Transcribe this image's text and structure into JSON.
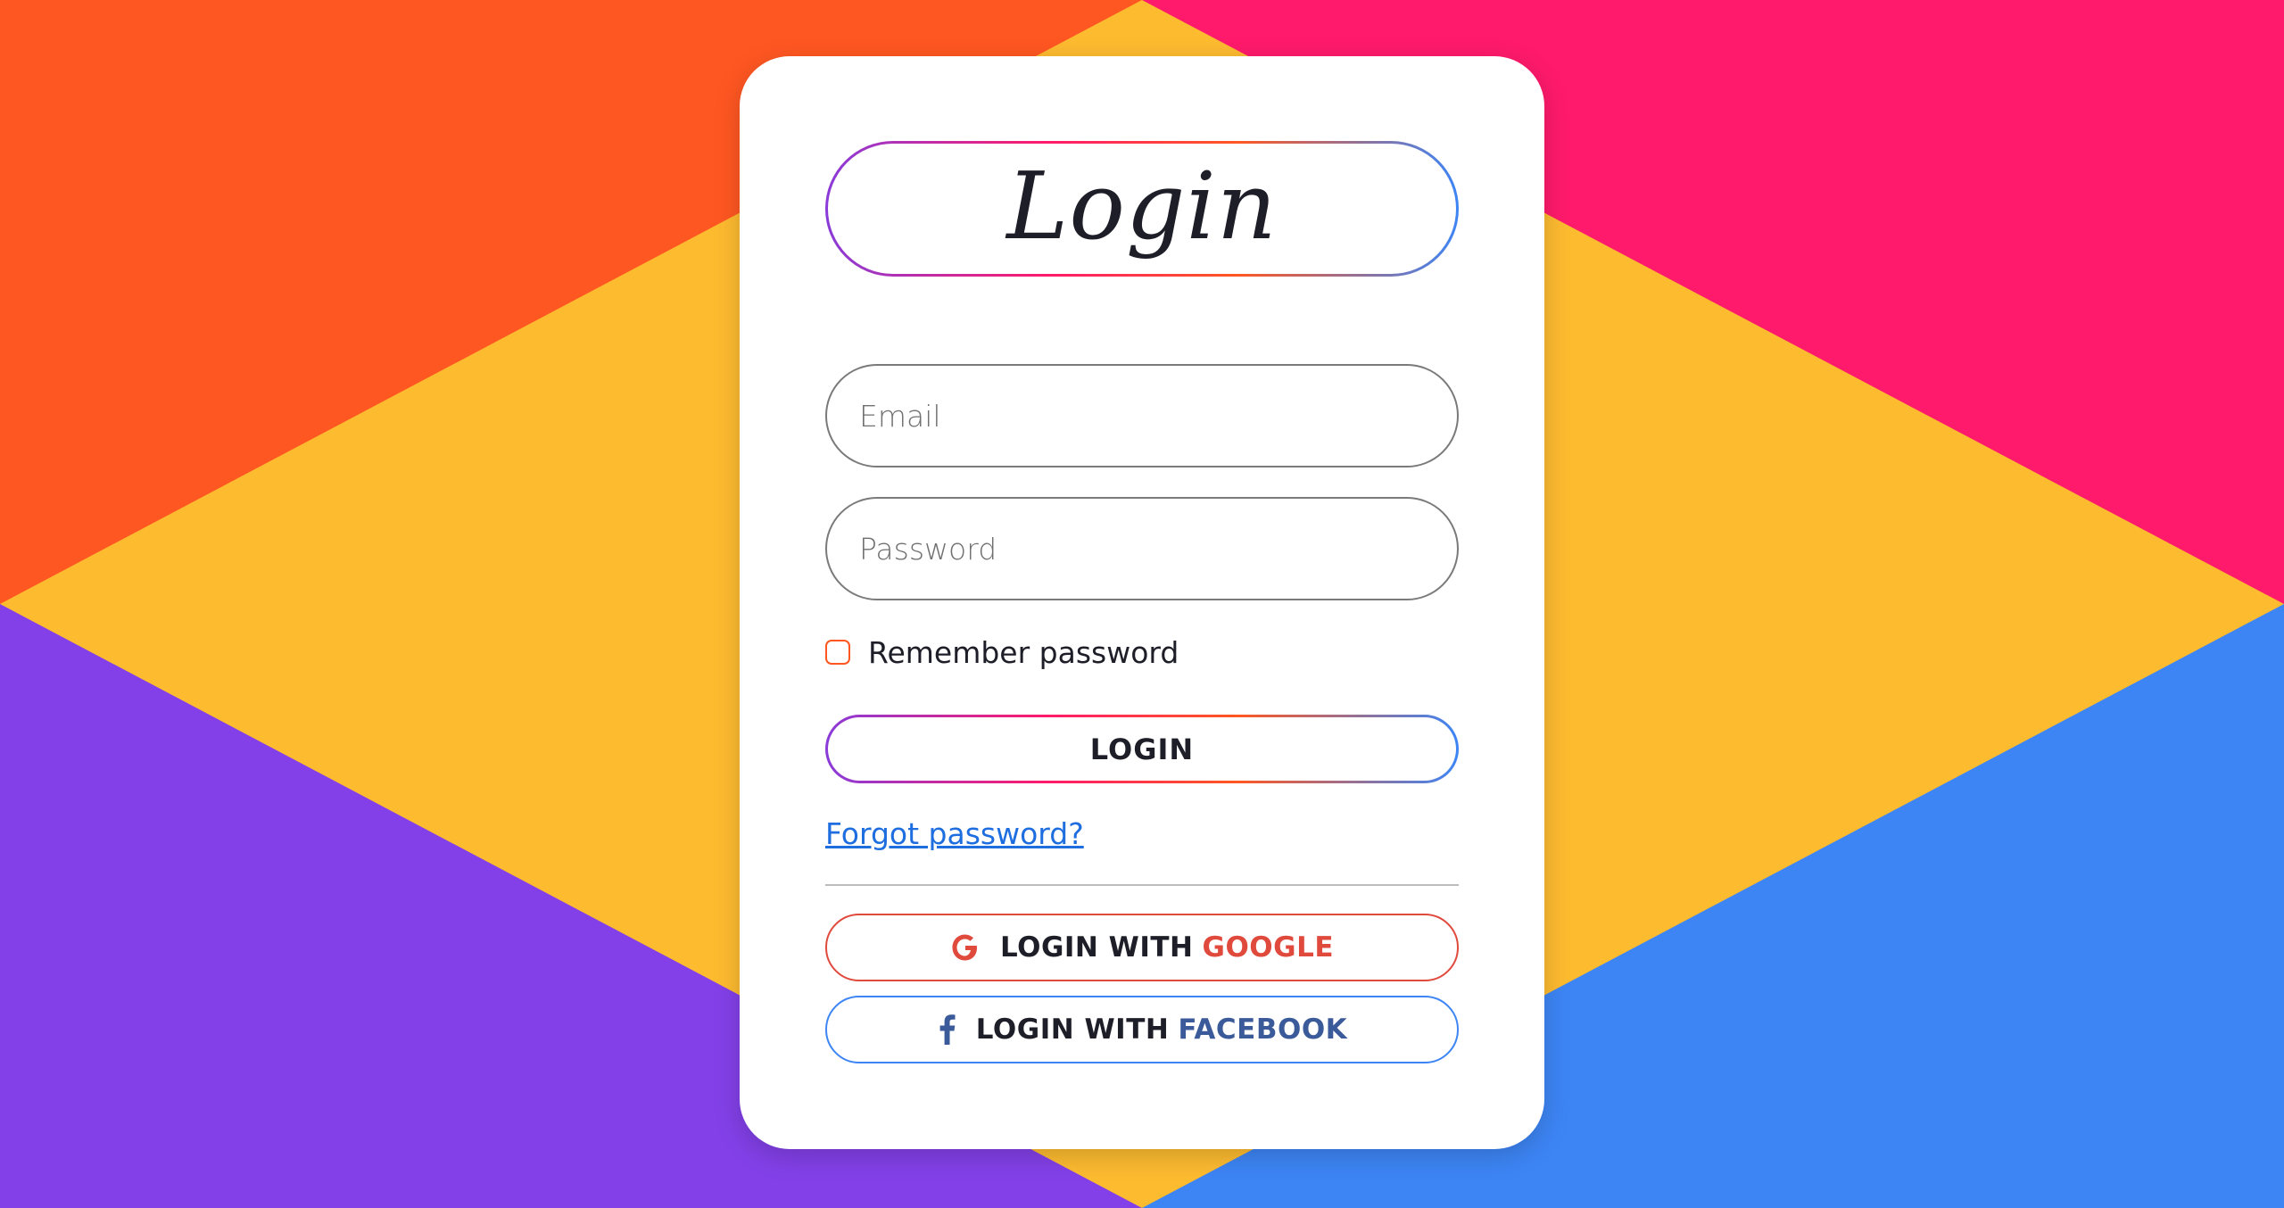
{
  "form": {
    "title": "Login",
    "email_placeholder": "Email",
    "password_placeholder": "Password",
    "remember_label": "Remember password",
    "login_label": "LOGIN",
    "forgot_label": "Forgot password?"
  },
  "social": {
    "google_prefix": "LOGIN WITH",
    "google_brand": "GOOGLE",
    "facebook_prefix": "LOGIN WITH",
    "facebook_brand": "FACEBOOK"
  },
  "colors": {
    "bg_top_left": "#FF5722",
    "bg_top_right": "#FF1A6B",
    "bg_center": "#FDBB30",
    "bg_bottom_left": "#8340E8",
    "bg_bottom_right": "#3D85F5",
    "google_red": "#E04A3D",
    "facebook_blue": "#3B5A9A",
    "link_blue": "#1F6EE0"
  }
}
